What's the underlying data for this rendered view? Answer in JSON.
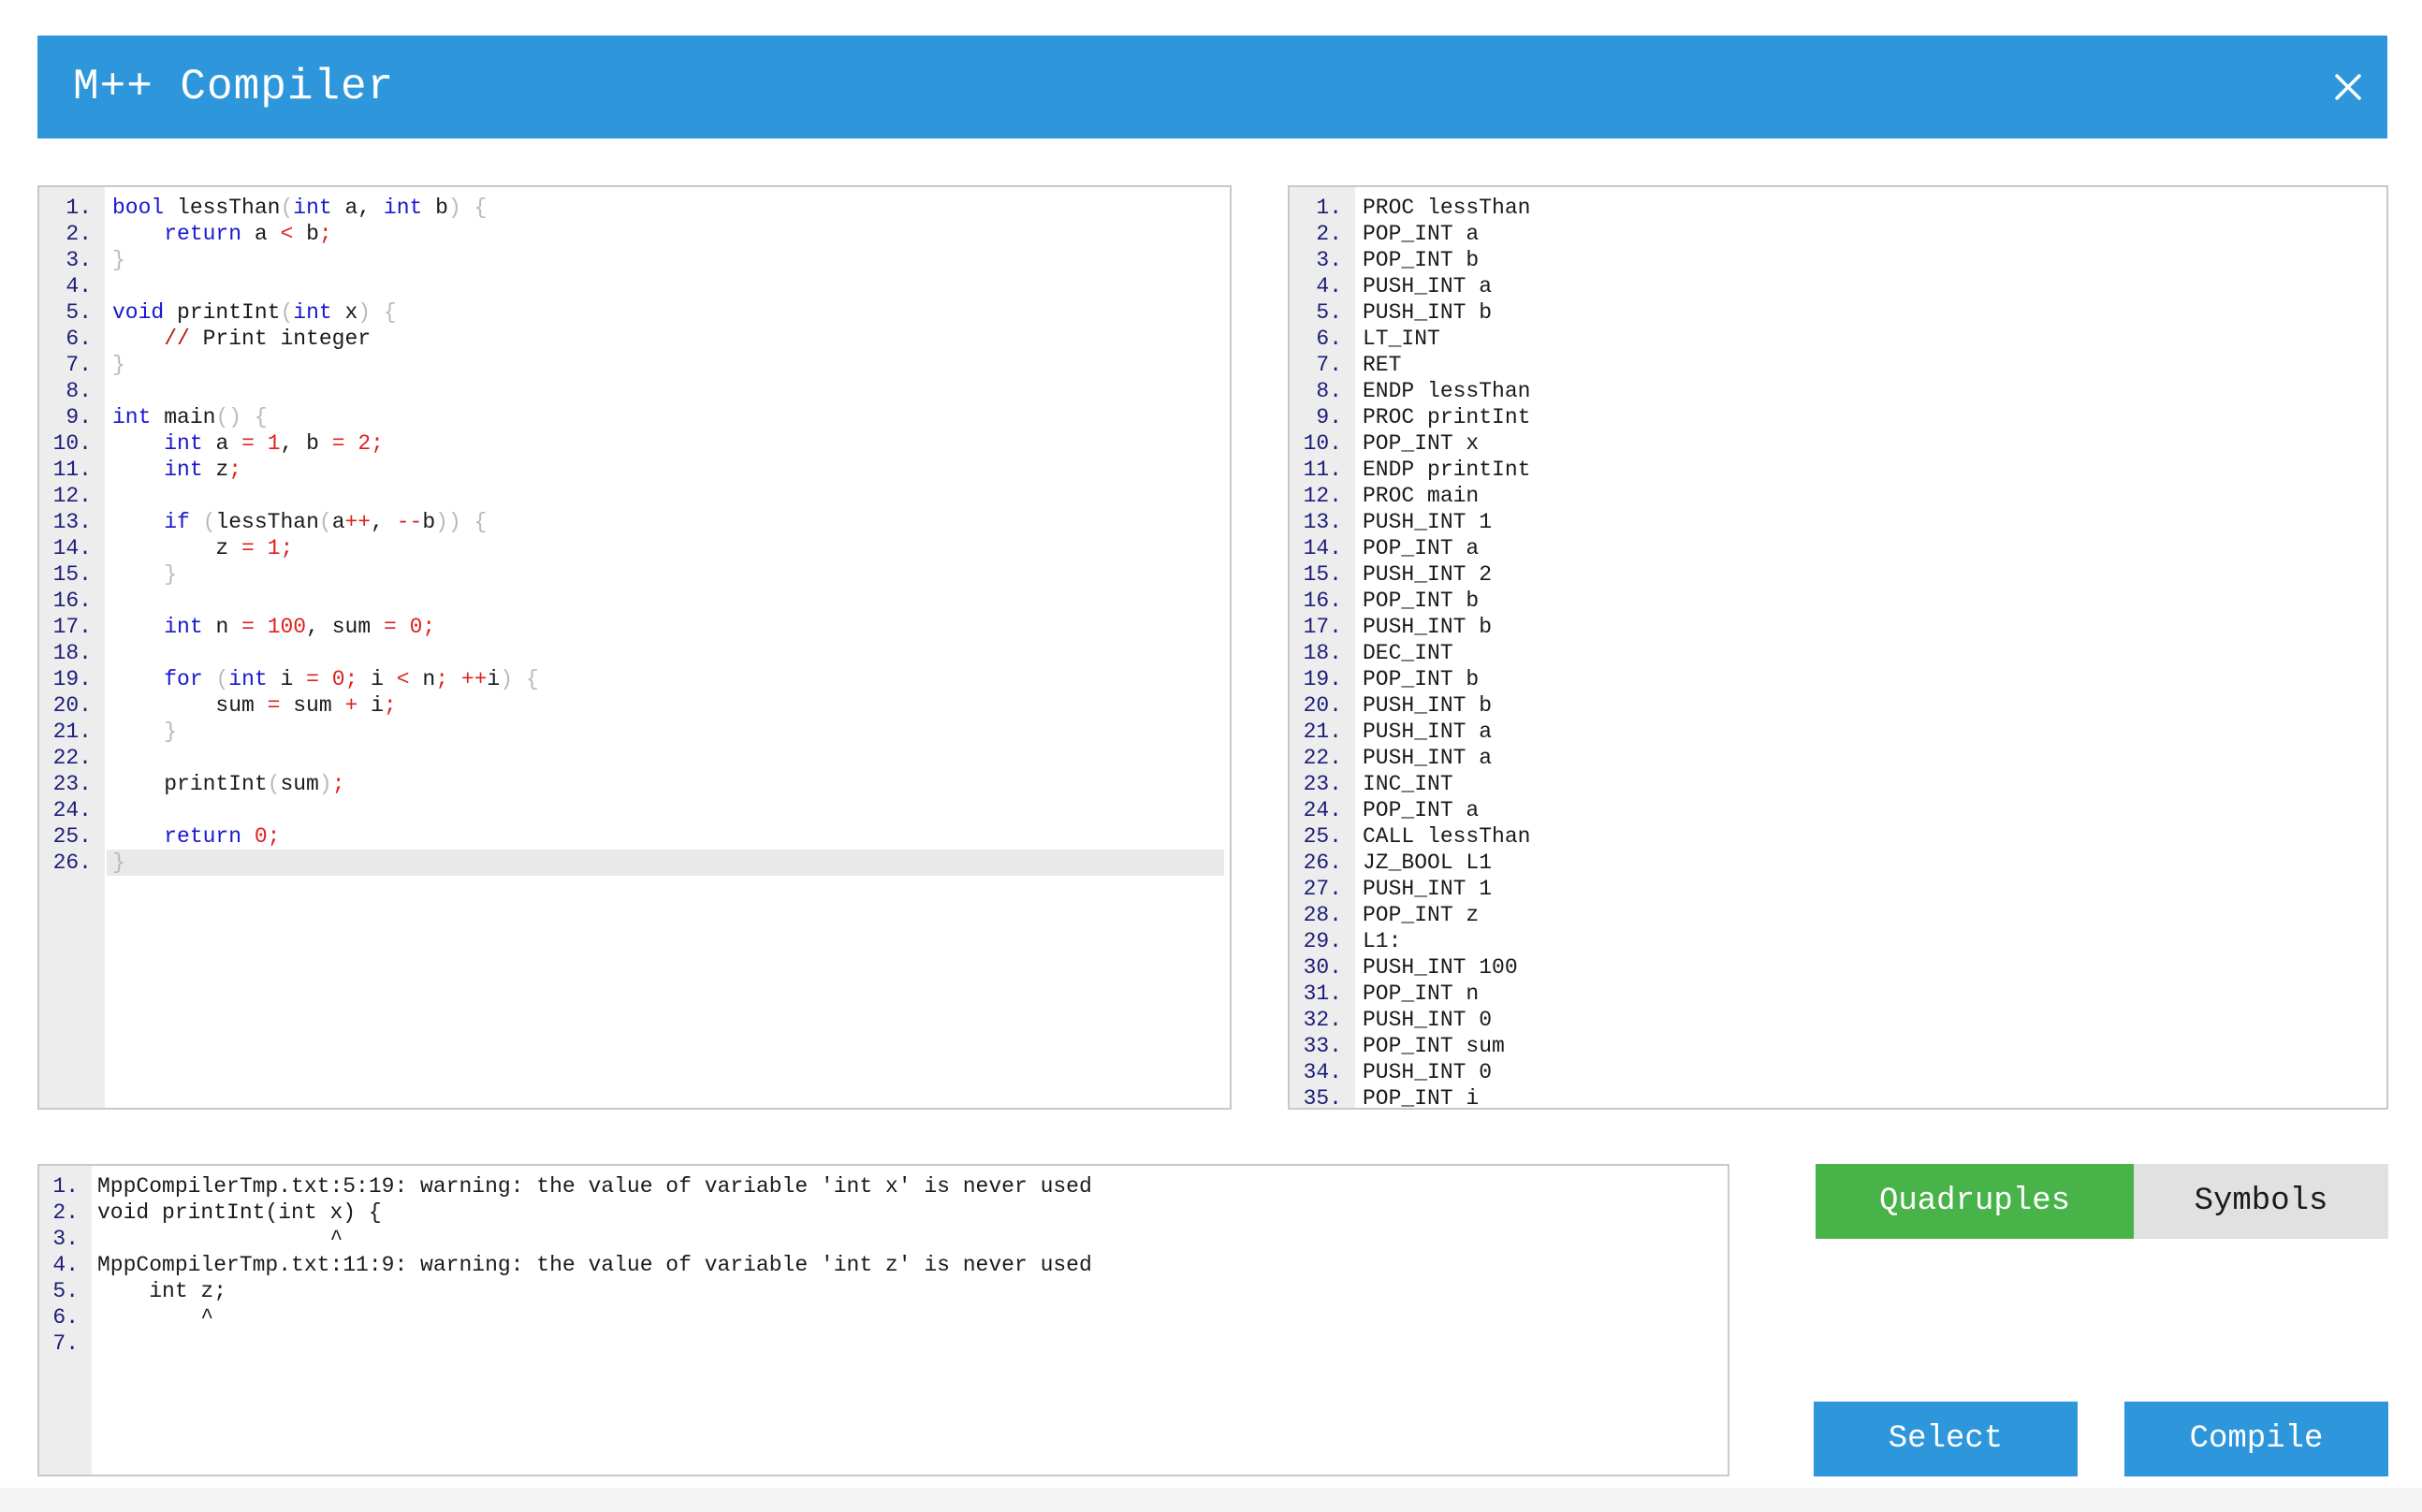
{
  "window": {
    "title": "M++ Compiler",
    "close_icon": "close-icon",
    "accent_color": "#2e97dc"
  },
  "editor": {
    "lines": [
      [
        [
          "kw",
          "bool"
        ],
        [
          "nm",
          " lessThan"
        ],
        [
          "pn",
          "("
        ],
        [
          "kw",
          "int"
        ],
        [
          "nm",
          " a, "
        ],
        [
          "kw",
          "int"
        ],
        [
          "nm",
          " b"
        ],
        [
          "pn",
          ") {"
        ]
      ],
      [
        [
          "nm",
          "    "
        ],
        [
          "kw",
          "return"
        ],
        [
          "nm",
          " a "
        ],
        [
          "op",
          "<"
        ],
        [
          "nm",
          " b"
        ],
        [
          "op",
          ";"
        ]
      ],
      [
        [
          "pn",
          "}"
        ]
      ],
      [],
      [
        [
          "kw",
          "void"
        ],
        [
          "nm",
          " printInt"
        ],
        [
          "pn",
          "("
        ],
        [
          "kw",
          "int"
        ],
        [
          "nm",
          " x"
        ],
        [
          "pn",
          ") {"
        ]
      ],
      [
        [
          "nm",
          "    "
        ],
        [
          "cm",
          "//"
        ],
        [
          "nm",
          " Print integer"
        ]
      ],
      [
        [
          "pn",
          "}"
        ]
      ],
      [],
      [
        [
          "kw",
          "int"
        ],
        [
          "nm",
          " main"
        ],
        [
          "pn",
          "() {"
        ]
      ],
      [
        [
          "nm",
          "    "
        ],
        [
          "kw",
          "int"
        ],
        [
          "nm",
          " a "
        ],
        [
          "op",
          "="
        ],
        [
          "nm",
          " "
        ],
        [
          "op",
          "1"
        ],
        [
          "nm",
          ", b "
        ],
        [
          "op",
          "="
        ],
        [
          "nm",
          " "
        ],
        [
          "op",
          "2;"
        ]
      ],
      [
        [
          "nm",
          "    "
        ],
        [
          "kw",
          "int"
        ],
        [
          "nm",
          " z"
        ],
        [
          "op",
          ";"
        ]
      ],
      [],
      [
        [
          "nm",
          "    "
        ],
        [
          "kw",
          "if"
        ],
        [
          "nm",
          " "
        ],
        [
          "pn",
          "("
        ],
        [
          "nm",
          "lessThan"
        ],
        [
          "pn",
          "("
        ],
        [
          "nm",
          "a"
        ],
        [
          "op",
          "++"
        ],
        [
          "nm",
          ", "
        ],
        [
          "op",
          "--"
        ],
        [
          "nm",
          "b"
        ],
        [
          "pn",
          ")) {"
        ]
      ],
      [
        [
          "nm",
          "        z "
        ],
        [
          "op",
          "="
        ],
        [
          "nm",
          " "
        ],
        [
          "op",
          "1;"
        ]
      ],
      [
        [
          "nm",
          "    "
        ],
        [
          "pn",
          "}"
        ]
      ],
      [],
      [
        [
          "nm",
          "    "
        ],
        [
          "kw",
          "int"
        ],
        [
          "nm",
          " n "
        ],
        [
          "op",
          "="
        ],
        [
          "nm",
          " "
        ],
        [
          "op",
          "100"
        ],
        [
          "nm",
          ", sum "
        ],
        [
          "op",
          "="
        ],
        [
          "nm",
          " "
        ],
        [
          "op",
          "0;"
        ]
      ],
      [],
      [
        [
          "nm",
          "    "
        ],
        [
          "kw",
          "for"
        ],
        [
          "nm",
          " "
        ],
        [
          "pn",
          "("
        ],
        [
          "kw",
          "int"
        ],
        [
          "nm",
          " i "
        ],
        [
          "op",
          "="
        ],
        [
          "nm",
          " "
        ],
        [
          "op",
          "0;"
        ],
        [
          "nm",
          " i "
        ],
        [
          "op",
          "<"
        ],
        [
          "nm",
          " n"
        ],
        [
          "op",
          ";"
        ],
        [
          "nm",
          " "
        ],
        [
          "op",
          "++"
        ],
        [
          "nm",
          "i"
        ],
        [
          "pn",
          ") {"
        ]
      ],
      [
        [
          "nm",
          "        sum "
        ],
        [
          "op",
          "="
        ],
        [
          "nm",
          " sum "
        ],
        [
          "op",
          "+"
        ],
        [
          "nm",
          " i"
        ],
        [
          "op",
          ";"
        ]
      ],
      [
        [
          "nm",
          "    "
        ],
        [
          "pn",
          "}"
        ]
      ],
      [],
      [
        [
          "nm",
          "    printInt"
        ],
        [
          "pn",
          "("
        ],
        [
          "nm",
          "sum"
        ],
        [
          "pn",
          ")"
        ],
        [
          "op",
          ";"
        ]
      ],
      [],
      [
        [
          "nm",
          "    "
        ],
        [
          "kw",
          "return"
        ],
        [
          "nm",
          " "
        ],
        [
          "op",
          "0;"
        ]
      ],
      [
        [
          "pn",
          "}"
        ]
      ]
    ],
    "active_line": 26
  },
  "output": {
    "lines": [
      "PROC lessThan",
      "POP_INT a",
      "POP_INT b",
      "PUSH_INT a",
      "PUSH_INT b",
      "LT_INT",
      "RET",
      "ENDP lessThan",
      "PROC printInt",
      "POP_INT x",
      "ENDP printInt",
      "PROC main",
      "PUSH_INT 1",
      "POP_INT a",
      "PUSH_INT 2",
      "POP_INT b",
      "PUSH_INT b",
      "DEC_INT",
      "POP_INT b",
      "PUSH_INT b",
      "PUSH_INT a",
      "PUSH_INT a",
      "INC_INT",
      "POP_INT a",
      "CALL lessThan",
      "JZ_BOOL L1",
      "PUSH_INT 1",
      "POP_INT z",
      "L1:",
      "PUSH_INT 100",
      "POP_INT n",
      "PUSH_INT 0",
      "POP_INT sum",
      "PUSH_INT 0",
      "POP_INT i"
    ]
  },
  "console": {
    "lines": [
      "MppCompilerTmp.txt:5:19: warning: the value of variable 'int x' is never used",
      "void printInt(int x) {",
      "                  ^",
      "MppCompilerTmp.txt:11:9: warning: the value of variable 'int z' is never used",
      "    int z;",
      "        ^",
      ""
    ]
  },
  "tabs": {
    "quadruples_label": "Quadruples",
    "symbols_label": "Symbols",
    "active": "Quadruples",
    "active_color": "#47b348"
  },
  "actions": {
    "select_label": "Select",
    "compile_label": "Compile"
  }
}
